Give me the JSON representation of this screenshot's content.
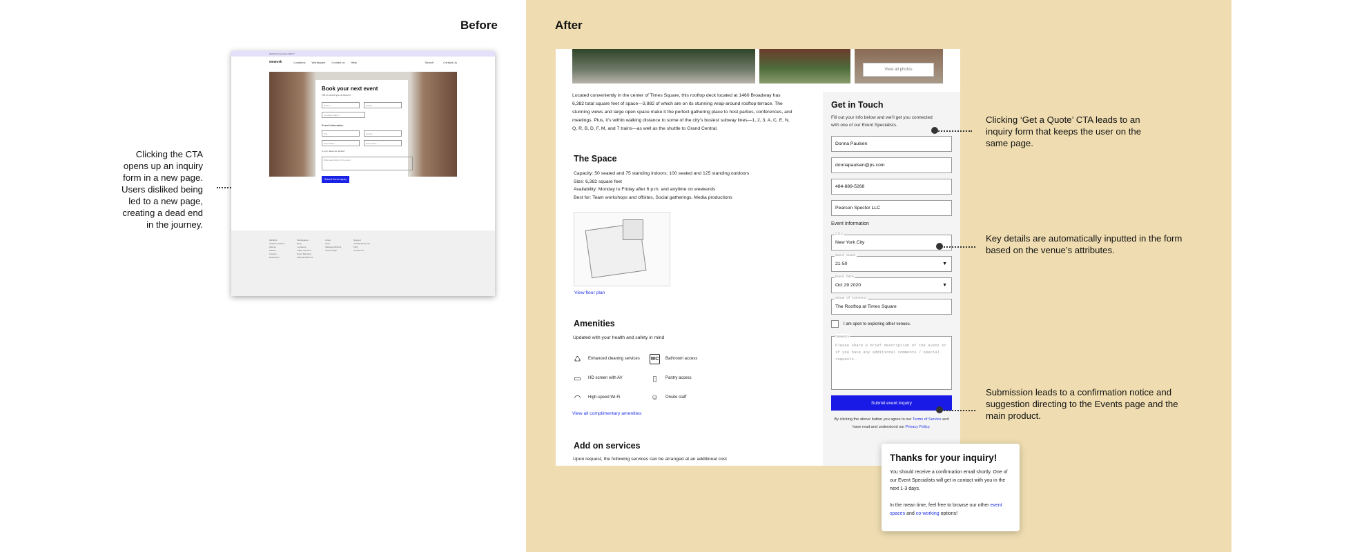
{
  "labels": {
    "before": "Before",
    "after": "After"
  },
  "callouts": {
    "left": "Clicking the CTA opens up an inquiry form in a new page. Users disliked being led to a new page, creating a dead end in the journey.",
    "right1": "Clicking ‘Get a Quote’ CTA leads to an inquiry form that keeps the user on the same page.",
    "right2": "Key details are automatically inputted in the form based on the venue’s attributes.",
    "right3": "Submission leads to a confirmation notice and suggestion directing to the Events page and the main product."
  },
  "before_page": {
    "topbar": "WeWork Coworking 2020 ©",
    "logo": "wework",
    "nav": [
      "Locations",
      "Workspace",
      "Contact us",
      "Help"
    ],
    "nav_right": [
      "Search",
      "Contact Us"
    ],
    "form_title": "Book your next event",
    "form_sub": "Tell us about you & about it",
    "fields": [
      "Name *",
      "Email *",
      "Company Name *"
    ],
    "event_label": "Event Information",
    "event_fields": [
      "City",
      "Guests",
      "Event Date *",
      "Event Time *"
    ],
    "flex_question": "Is your date/time flexible?",
    "textarea": "Write description of the event",
    "submit": "Submit Event Inquiry",
    "footer_cols": [
      [
        "WeWork",
        "Global Locations",
        "WeLive",
        "Flatiron",
        "Careers",
        "Resources"
      ],
      [
        "Workspaces",
        "Blog",
        "Locations",
        "Office Services",
        "Event Planning",
        "Referral Partners"
      ],
      [
        "About",
        "Help",
        "Manage WeWork",
        "Sponsorship"
      ],
      [
        "Support",
        "COVID Response",
        "FAQ",
        "Contact Us"
      ]
    ]
  },
  "after_page": {
    "view_photos": "View all photos",
    "description": "Located conveniently in the center of Times Square, this rooftop deck located at 1460 Broadway has 6,382 total square feet of space—3,882 of which are on its stunning wrap-around rooftop terrace. The stunning views and large open space make it the perfect gathering place to host parties, conferences, and meetings.  Plus, it’s within walking distance to some of the city’s busiest subway lines—1, 2, 3, A, C, E, N, Q, R, B, D, F, M, and 7 trains—as well as the shuttle to Grand Central.",
    "space_title": "The Space",
    "space_lines": [
      "Capacity: 50 seated and 75 standing indoors; 100 seated and 125 standing outdoors",
      "Size: 6,382 square feet",
      "Availability: Monday to Friday after 6 p.m. and anytime on weekends",
      "Best for: Team workshops and offsites, Social gatherings, Media productions"
    ],
    "view_floor_plan": "View floor plan",
    "amenities_title": "Amenities",
    "amenities_sub": "Updated with your health and safety in mind",
    "amenities": [
      {
        "label": "Enhanced cleaning services",
        "icon": "cleaning-icon",
        "glyph": "♺"
      },
      {
        "label": "Bathroom access",
        "icon": "wc-icon",
        "glyph": "WC"
      },
      {
        "label": "HD screen with AV",
        "icon": "monitor-icon",
        "glyph": "▭"
      },
      {
        "label": "Pantry access",
        "icon": "fridge-icon",
        "glyph": "▯"
      },
      {
        "label": "High-speed Wi-Fi",
        "icon": "wifi-icon",
        "glyph": "◠"
      },
      {
        "label": "Onsite staff",
        "icon": "staff-icon",
        "glyph": "☺"
      }
    ],
    "view_amenities": "View all complimentary amenities",
    "addon_title": "Add on services",
    "addon_sub": "Upon request, the following services can be arranged at an additional cost"
  },
  "form": {
    "title": "Get in Touch",
    "intro": "Fill out your info below and we’ll get you connected with one of our Event Specialists.",
    "name": "Donna Paulsen",
    "email": "donnapaulsen@ps.com",
    "phone": "484-889-5268",
    "company": "Pearson Spector LLC",
    "event_label": "Event Information",
    "city_label": "City",
    "city": "New York City",
    "guest_label": "Guest Count",
    "guest": "21-50",
    "date_label": "Event Date",
    "date": "Oct 29 2020",
    "venue_label": "Venue of Interest",
    "venue": "The Rooftop at Times Square",
    "checkbox": "I am open to exploring other venues.",
    "comments_label": "Comments",
    "comments_placeholder": "Please share a brief description of the event or if you have any additional comments / special requests.",
    "submit": "Submit event inquiry",
    "terms_pre": "By clicking the above button you agree to our",
    "terms_link": "Terms of Service",
    "terms_mid": "and have read and understood our",
    "privacy_link": "Privacy Policy"
  },
  "thanks": {
    "title": "Thanks for your inquiry!",
    "p1": "You should receive a confirmation email shortly. One of our Event Specialists will get in contact with you in the next 1-3 days.",
    "p2_pre": "In the mean time, feel free to browse our other",
    "link1": "event spaces",
    "p2_mid": "and",
    "link2": "co-working",
    "p2_post": "options!"
  },
  "colors": {
    "after_bg": "#efddb1",
    "accent": "#1a1ae6",
    "link": "#2132e6"
  }
}
